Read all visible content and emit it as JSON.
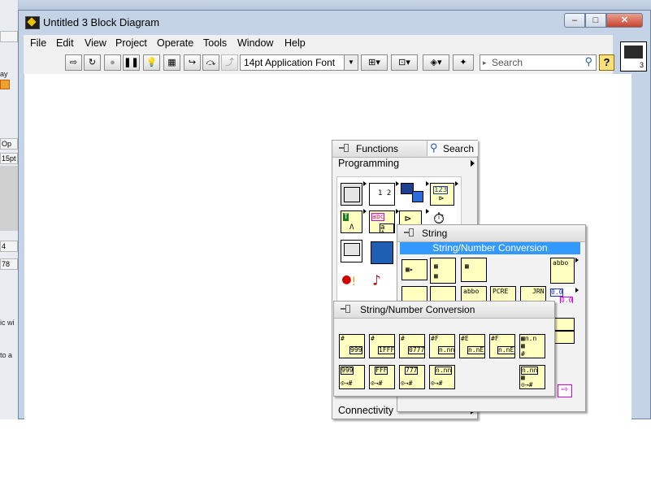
{
  "window": {
    "title": "Untitled 3 Block Diagram",
    "close_glyph": "✕",
    "max_glyph": "□",
    "min_glyph": "–"
  },
  "background_window": {
    "cells": [
      "Op",
      "15pt",
      "4",
      "78"
    ],
    "texts": [
      "ay",
      "ic wi",
      "to a"
    ]
  },
  "menu": [
    "File",
    "Edit",
    "View",
    "Project",
    "Operate",
    "Tools",
    "Window",
    "Help"
  ],
  "toolbar": {
    "font_label": "14pt Application Font",
    "search_placeholder": "Search",
    "help_label": "?"
  },
  "functions_palette": {
    "title": "Functions",
    "search_label": "Search",
    "category": "Programming",
    "bottom_category": "Connectivity"
  },
  "string_palette": {
    "title": "String",
    "highlighted_item": "String/Number Conversion"
  },
  "conversion_palette": {
    "title": "String/Number Conversion",
    "icons_row1": [
      "999",
      "1FFF",
      "0777",
      "n.nn",
      "n.nEn",
      "n.nE2",
      ""
    ],
    "icons_row2": [
      "999",
      "FFF",
      "777",
      "n.nn",
      "",
      "",
      "n.nn"
    ]
  },
  "programming_icons": [
    "1 2",
    "123",
    "abc",
    "abc"
  ],
  "string_icons": [
    "abbo",
    "PCRE",
    "JRN",
    "0.0",
    "0.0"
  ]
}
